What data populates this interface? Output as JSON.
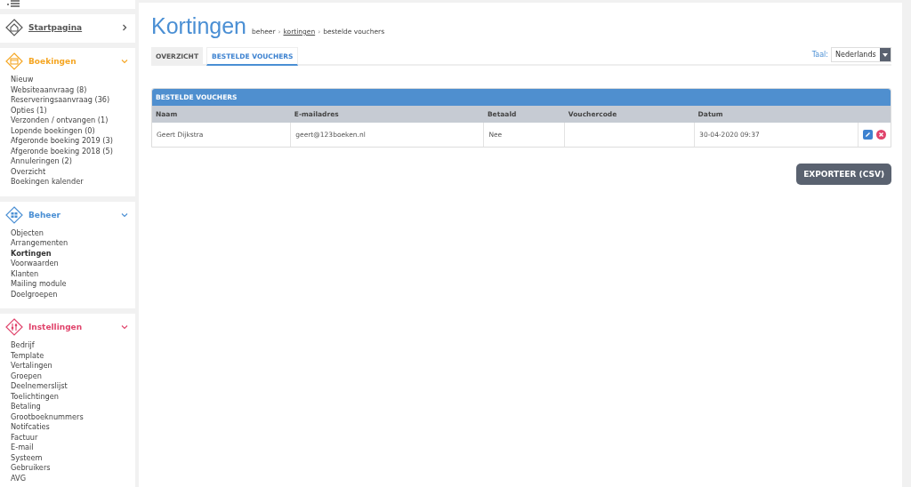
{
  "sidebar": {
    "sections": [
      {
        "title": "Startpagina",
        "kind": "home",
        "color": "#555555",
        "expanded": false
      },
      {
        "title": "Boekingen",
        "kind": "calendar",
        "color": "#f5a623",
        "expanded": true,
        "items": [
          {
            "label": "Nieuw",
            "selected": false
          },
          {
            "label": "Websiteaanvraag (8)",
            "selected": false
          },
          {
            "label": "Reserveringsaanvraag (36)",
            "selected": false
          },
          {
            "label": "Opties (1)",
            "selected": false
          },
          {
            "label": "Verzonden / ontvangen (1)",
            "selected": false
          },
          {
            "label": "Lopende boekingen (0)",
            "selected": false
          },
          {
            "label": "Afgeronde boeking 2019 (3)",
            "selected": false
          },
          {
            "label": "Afgeronde boeking 2018 (5)",
            "selected": false
          },
          {
            "label": "Annuleringen (2)",
            "selected": false
          },
          {
            "label": "Overzicht",
            "selected": false
          },
          {
            "label": "Boekingen kalender",
            "selected": false
          }
        ]
      },
      {
        "title": "Beheer",
        "kind": "grid",
        "color": "#4a8fd4",
        "expanded": true,
        "items": [
          {
            "label": "Objecten",
            "selected": false
          },
          {
            "label": "Arrangementen",
            "selected": false
          },
          {
            "label": "Kortingen",
            "selected": true
          },
          {
            "label": "Voorwaarden",
            "selected": false
          },
          {
            "label": "Klanten",
            "selected": false
          },
          {
            "label": "Mailing module",
            "selected": false
          },
          {
            "label": "Doelgroepen",
            "selected": false
          }
        ]
      },
      {
        "title": "Instellingen",
        "kind": "sliders",
        "color": "#e0436b",
        "expanded": true,
        "items": [
          {
            "label": "Bedrijf",
            "selected": false
          },
          {
            "label": "Template",
            "selected": false
          },
          {
            "label": "Vertalingen",
            "selected": false
          },
          {
            "label": "Groepen",
            "selected": false
          },
          {
            "label": "Deelnemerslijst",
            "selected": false
          },
          {
            "label": "Toelichtingen",
            "selected": false
          },
          {
            "label": "Betaling",
            "selected": false
          },
          {
            "label": "Grootboeknummers",
            "selected": false
          },
          {
            "label": "Notifcaties",
            "selected": false
          },
          {
            "label": "Factuur",
            "selected": false
          },
          {
            "label": "E-mail",
            "selected": false
          },
          {
            "label": "Systeem",
            "selected": false
          },
          {
            "label": "Gebruikers",
            "selected": false
          },
          {
            "label": "AVG",
            "selected": false
          }
        ]
      }
    ]
  },
  "page": {
    "title": "Kortingen",
    "breadcrumb": [
      {
        "kind": "text",
        "label": "beheer"
      },
      {
        "kind": "separator",
        "label": "›"
      },
      {
        "kind": "link",
        "label": "kortingen"
      },
      {
        "kind": "separator",
        "label": "›"
      },
      {
        "kind": "text",
        "label": "bestelde vouchers"
      }
    ]
  },
  "tabs": [
    {
      "label": "OVERZICHT",
      "selected": false
    },
    {
      "label": "BESTELDE VOUCHERS",
      "selected": true
    }
  ],
  "language": {
    "label": "Taal:",
    "value": "Nederlands"
  },
  "table": {
    "title": "BESTELDE VOUCHERS",
    "columns": [
      "Naam",
      "E-mailadres",
      "Betaald",
      "Vouchercode",
      "Datum"
    ],
    "rows": [
      [
        "Geert Dijkstra",
        "geert@123boeken.nl",
        "Nee",
        "",
        "30-04-2020 09:37"
      ]
    ]
  },
  "export_button": "EXPORTEER (CSV)"
}
